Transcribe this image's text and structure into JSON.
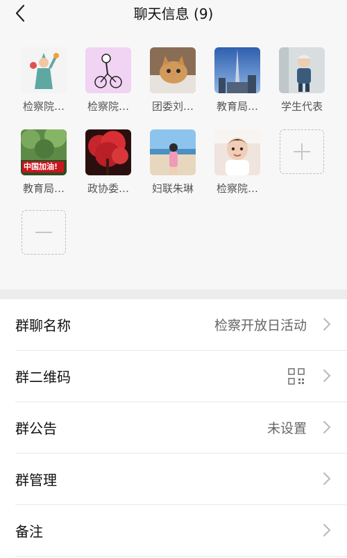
{
  "header": {
    "title": "聊天信息 (9)"
  },
  "members": [
    {
      "name": "检察院…",
      "avatar": "statue-of-liberty-avatar",
      "bg": "#f3f3f3"
    },
    {
      "name": "检察院…",
      "avatar": "cyclist-sketch-avatar",
      "bg": "#f2d6f4"
    },
    {
      "name": "团委刘…",
      "avatar": "cat-avatar",
      "bg": "#c9a17a"
    },
    {
      "name": "教育局…",
      "avatar": "skyscraper-avatar",
      "bg": "#4a78c2"
    },
    {
      "name": "学生代表",
      "avatar": "toddler-photo-avatar",
      "bg": "#cfd8dc"
    },
    {
      "name": "教育局…",
      "avatar": "china-cheer-avatar",
      "bg": "#5f8f4d",
      "badge": "中国加油!"
    },
    {
      "name": "政协委…",
      "avatar": "red-tree-avatar",
      "bg": "#b3262b"
    },
    {
      "name": "妇联朱琳",
      "avatar": "beach-person-avatar",
      "bg": "#7fb7e0"
    },
    {
      "name": "检察院…",
      "avatar": "baby-photo-avatar",
      "bg": "#e9dcd4"
    }
  ],
  "settings": {
    "group_name": {
      "label": "群聊名称",
      "value": "检察开放日活动"
    },
    "qr_code": {
      "label": "群二维码"
    },
    "announcement": {
      "label": "群公告",
      "value": "未设置"
    },
    "manage": {
      "label": "群管理"
    },
    "remark": {
      "label": "备注"
    }
  },
  "colors": {
    "background": "#f7f7f7",
    "divider": "#ececec",
    "row": "#ffffff",
    "muted_text": "#666666"
  }
}
